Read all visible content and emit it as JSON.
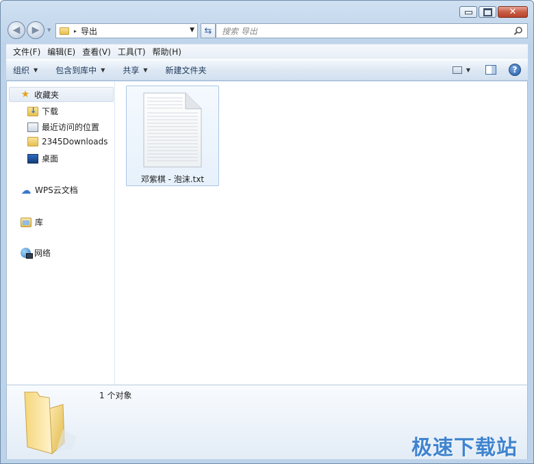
{
  "window": {
    "caption_buttons": {
      "minimize": "minimize",
      "maximize": "maximize",
      "close": "close"
    }
  },
  "address": {
    "crumb": "导出",
    "separator": "▸"
  },
  "search": {
    "placeholder": "搜索 导出"
  },
  "menubar": {
    "items": [
      {
        "label": "文件(F)"
      },
      {
        "label": "编辑(E)"
      },
      {
        "label": "查看(V)"
      },
      {
        "label": "工具(T)"
      },
      {
        "label": "帮助(H)"
      }
    ]
  },
  "commandbar": {
    "organize": "组织",
    "include_library": "包含到库中",
    "share": "共享",
    "new_folder": "新建文件夹"
  },
  "nav": {
    "favorites": "收藏夹",
    "downloads": "下载",
    "recent": "最近访问的位置",
    "downloads2345": "2345Downloads",
    "desktop": "桌面",
    "wps": "WPS云文档",
    "library": "库",
    "network": "网络"
  },
  "files": [
    {
      "name": "邓紫棋 - 泡沫.txt",
      "type": "text-file-icon"
    }
  ],
  "details": {
    "count": "1 个对象"
  },
  "watermark": "极速下载站",
  "colors": {
    "accent": "#3f84cf",
    "close_button": "#c75c44",
    "selection": "#e7f1fb"
  }
}
